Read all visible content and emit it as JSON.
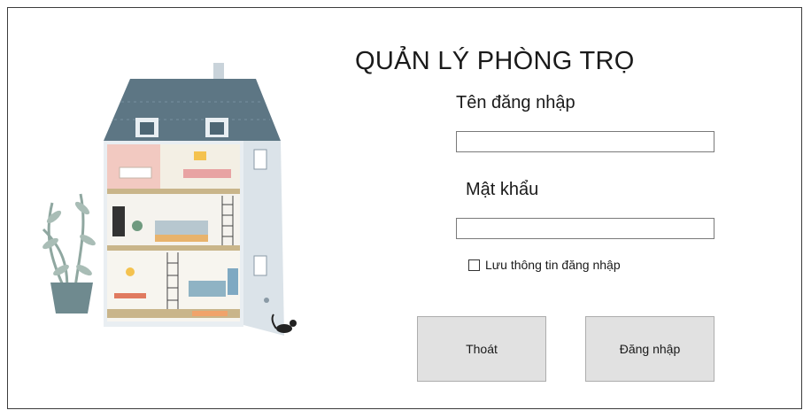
{
  "form": {
    "title": "QUẢN LÝ PHÒNG TRỌ",
    "username_label": "Tên đăng nhập",
    "username_value": "",
    "password_label": "Mật khẩu",
    "password_value": "",
    "remember_label": "Lưu thông tin đăng nhập",
    "remember_checked": false,
    "exit_button": "Thoát",
    "login_button": "Đăng nhập"
  },
  "illustration": {
    "description_icon": "house-illustration",
    "colors": {
      "roof": "#5d7684",
      "wall": "#dfe6ec",
      "floor": "#c9b58a",
      "plant": "#7f9a92"
    }
  }
}
